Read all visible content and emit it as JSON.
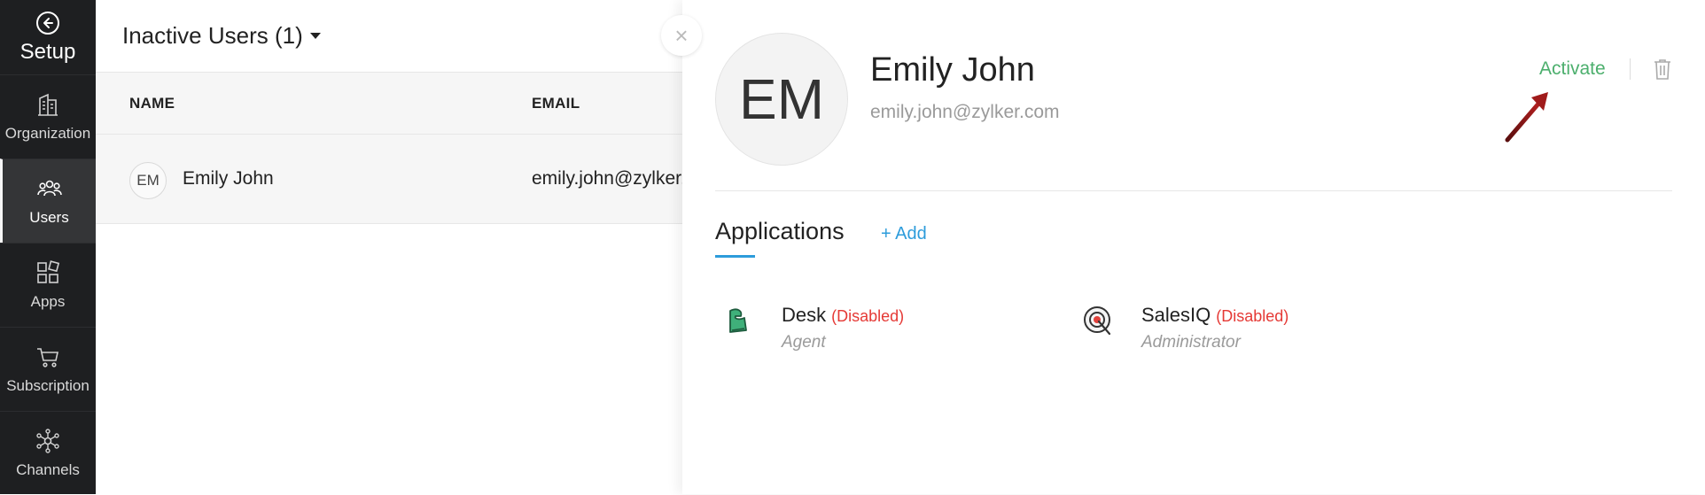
{
  "sidebar": {
    "title": "Setup",
    "items": [
      {
        "label": "Organization",
        "icon": "building-icon"
      },
      {
        "label": "Users",
        "icon": "users-icon",
        "active": true
      },
      {
        "label": "Apps",
        "icon": "apps-grid-icon"
      },
      {
        "label": "Subscription",
        "icon": "cart-icon"
      },
      {
        "label": "Channels",
        "icon": "network-icon"
      }
    ]
  },
  "list": {
    "title": "Inactive Users (1)",
    "columns": {
      "name": "NAME",
      "email": "EMAIL"
    },
    "rows": [
      {
        "initials": "EM",
        "name": "Emily John",
        "email": "emily.john@zylker.com"
      }
    ]
  },
  "close_label": "×",
  "detail": {
    "initials": "EM",
    "name": "Emily John",
    "email": "emily.john@zylker.com",
    "activate_label": "Activate",
    "applications_title": "Applications",
    "add_label": "+ Add",
    "apps": [
      {
        "name": "Desk",
        "status": "(Disabled)",
        "role": "Agent",
        "icon": "desk-icon"
      },
      {
        "name": "SalesIQ",
        "status": "(Disabled)",
        "role": "Administrator",
        "icon": "salesiq-icon"
      }
    ]
  },
  "colors": {
    "sidebar_bg": "#1e1f21",
    "activate": "#4caf6d",
    "link": "#2d9cdb",
    "disabled": "#e53935",
    "annotation_arrow": "#9b1c1c"
  }
}
